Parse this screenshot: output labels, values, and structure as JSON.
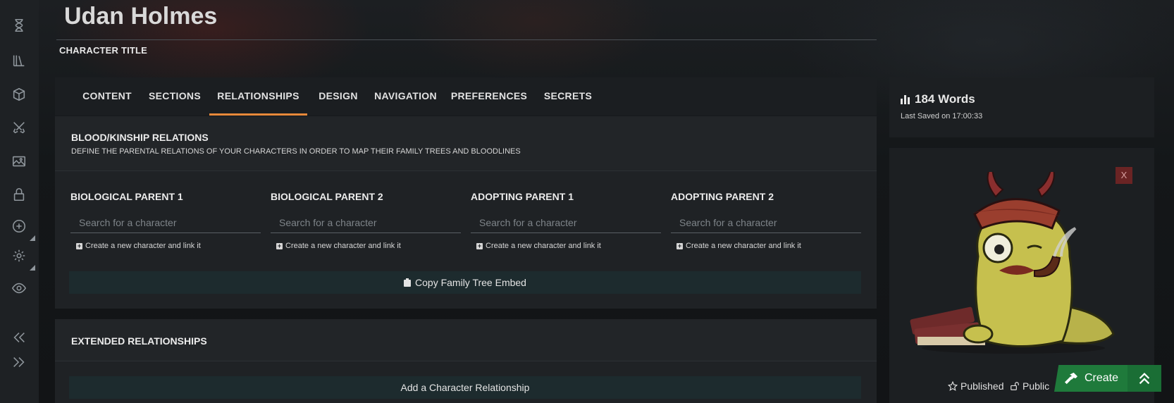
{
  "page": {
    "title": "Udan Holmes",
    "subtitle": "CHARACTER TITLE"
  },
  "sidebar": {
    "icons": [
      "hourglass-icon",
      "library-icon",
      "cube-icon",
      "swords-icon",
      "image-icon",
      "lock-icon",
      "plus-circle-icon",
      "gear-icon",
      "eye-icon",
      "collapse-icon",
      "expand-icon"
    ]
  },
  "tabs": [
    {
      "label": "CONTENT"
    },
    {
      "label": "SECTIONS"
    },
    {
      "label": "RELATIONSHIPS",
      "active": true
    },
    {
      "label": "DESIGN"
    },
    {
      "label": "NAVIGATION"
    },
    {
      "label": "PREFERENCES"
    },
    {
      "label": "SECRETS"
    }
  ],
  "blood": {
    "heading": "BLOOD/KINSHIP RELATIONS",
    "description": "DEFINE THE PARENTAL RELATIONS OF YOUR CHARACTERS IN ORDER TO MAP THEIR FAMILY TREES AND BLOODLINES",
    "parents": [
      {
        "label": "BIOLOGICAL PARENT 1",
        "placeholder": "Search for a character",
        "value": "",
        "create_link": "Create a new character and link it"
      },
      {
        "label": "BIOLOGICAL PARENT 2",
        "placeholder": "Search for a character",
        "value": "",
        "create_link": "Create a new character and link it"
      },
      {
        "label": "ADOPTING PARENT 1",
        "placeholder": "Search for a character",
        "value": "",
        "create_link": "Create a new character and link it"
      },
      {
        "label": "ADOPTING PARENT 2",
        "placeholder": "Search for a character",
        "value": "",
        "create_link": "Create a new character and link it"
      }
    ],
    "copy_button": "Copy Family Tree Embed"
  },
  "extended": {
    "heading": "EXTENDED RELATIONSHIPS",
    "add_button": "Add a Character Relationship"
  },
  "stats": {
    "words": "184 Words",
    "last_saved": "Last Saved on 17:00:33"
  },
  "close_label": "X",
  "footer": {
    "published": "Published",
    "public": "Public",
    "create": "Create"
  },
  "colors": {
    "accent_tab": "#e8893a",
    "create_green": "#1f7a3b",
    "close_red": "#6a2424",
    "button_teal": "#1d2b2e"
  }
}
